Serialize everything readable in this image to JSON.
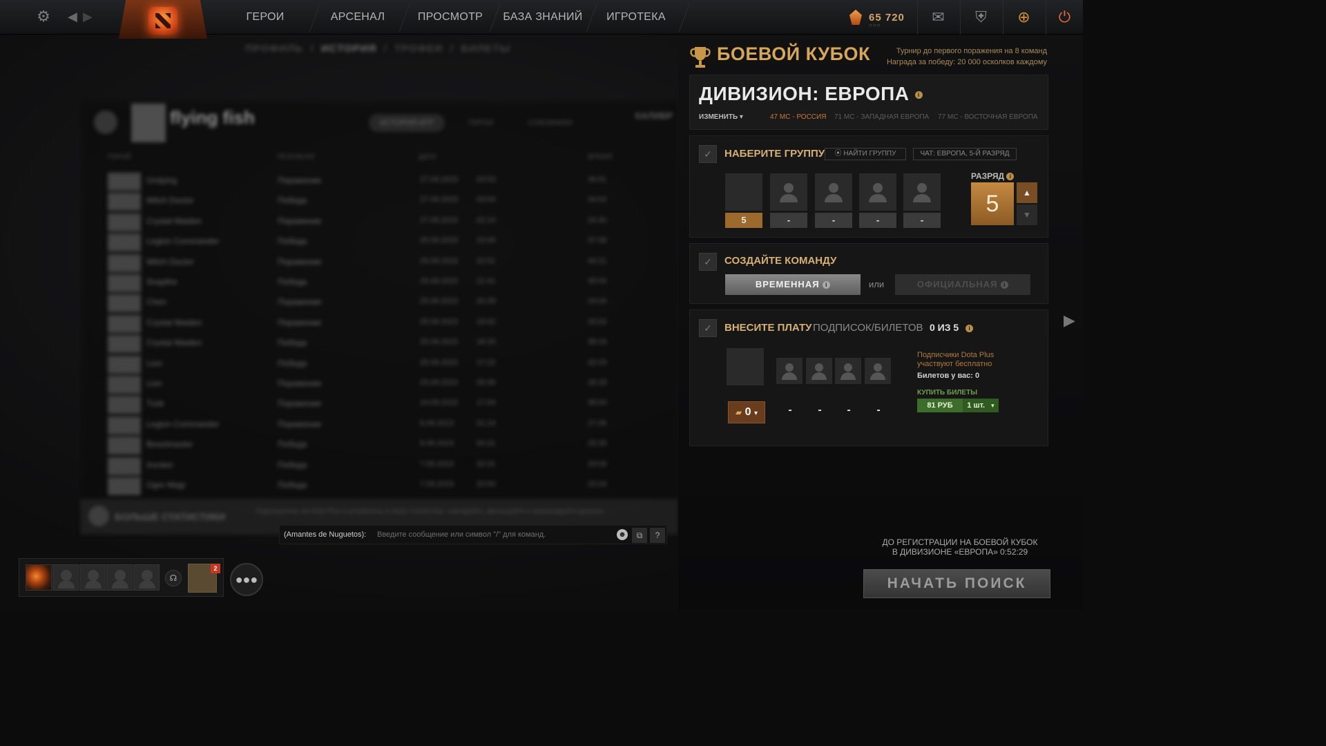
{
  "nav": {
    "items": [
      "ГЕРОИ",
      "АРСЕНАЛ",
      "ПРОСМОТР",
      "БАЗА ЗНАНИЙ",
      "ИГРОТЕКА"
    ],
    "shards": "65 720",
    "shard_sub": "○○○"
  },
  "background": {
    "crumbs": [
      "ПРОФИЛЬ",
      "ИСТОРИЯ",
      "ТРОФЕИ",
      "БИЛЕТЫ"
    ],
    "player_name": "flying fish",
    "tabs": [
      "ИСТОРИЯ ИГР",
      "ГЕРОИ",
      "СОЮЗНИКИ"
    ],
    "columns": [
      "ГЕРОЙ",
      "РЕЗУЛЬТАТ",
      "ДАТА",
      "ВРЕМЯ"
    ],
    "rows": [
      {
        "hero": "Undying",
        "result": "Поражение",
        "date": "27.09.2023",
        "time": "03:53",
        "dur": "36:01"
      },
      {
        "hero": "Witch Doctor",
        "result": "Победа",
        "date": "27.09.2023",
        "time": "03:04",
        "dur": "34:02"
      },
      {
        "hero": "Crystal Maiden",
        "result": "Поражение",
        "date": "27.09.2023",
        "time": "02:14",
        "dur": "24:40"
      },
      {
        "hero": "Legion Commander",
        "result": "Победа",
        "date": "25.09.2023",
        "time": "23:49",
        "dur": "37:08"
      },
      {
        "hero": "Witch Doctor",
        "result": "Поражение",
        "date": "25.09.2023",
        "time": "22:51",
        "dur": "44:21"
      },
      {
        "hero": "Snapfire",
        "result": "Победа",
        "date": "25.09.2023",
        "time": "21:41",
        "dur": "45:04"
      },
      {
        "hero": "Chen",
        "result": "Поражение",
        "date": "25.09.2023",
        "time": "20:39",
        "dur": "24:04"
      },
      {
        "hero": "Crystal Maiden",
        "result": "Поражение",
        "date": "25.09.2023",
        "time": "19:42",
        "dur": "33:02"
      },
      {
        "hero": "Crystal Maiden",
        "result": "Победа",
        "date": "25.09.2023",
        "time": "18:33",
        "dur": "38:16"
      },
      {
        "hero": "Lion",
        "result": "Победа",
        "date": "25.09.2023",
        "time": "17:22",
        "dur": "42:03"
      },
      {
        "hero": "Lion",
        "result": "Поражение",
        "date": "25.09.2023",
        "time": "00:46",
        "dur": "28:28"
      },
      {
        "hero": "Tusk",
        "result": "Поражение",
        "date": "14.09.2023",
        "time": "17:04",
        "dur": "38:00"
      },
      {
        "hero": "Legion Commander",
        "result": "Поражение",
        "date": "8.09.2023",
        "time": "01:24",
        "dur": "27:06"
      },
      {
        "hero": "Beastmaster",
        "result": "Победа",
        "date": "8.09.2023",
        "time": "00:31",
        "dur": "25:35"
      },
      {
        "hero": "Invoker",
        "result": "Победа",
        "date": "7.09.2023",
        "time": "22:31",
        "dur": "29:06"
      },
      {
        "hero": "Ogre Magi",
        "result": "Победа",
        "date": "7.09.2023",
        "time": "20:50",
        "dur": "20:04"
      }
    ],
    "more_stats_title": "БОЛЬШЕ СТАТИСТИКИ",
    "more_stats_desc": "Подпишитесь на Dota Plus и углубитесь в свою статистику: сортируйте, фильтруйте и анализируйте данные...",
    "side_partial": "КАЛИБР"
  },
  "chat": {
    "channel": "(Amantes de Nuguetos):",
    "placeholder": "Введите сообщение или символ \"/\" для команд.",
    "help": "?"
  },
  "party": {
    "friend_badge": "2"
  },
  "battlecup": {
    "title": "БОЕВОЙ КУБОК",
    "sub1": "Турнир до первого поражения на 8 команд",
    "sub2": "Награда за победу: 20 000 осколков каждому",
    "division_title": "ДИВИЗИОН: ЕВРОПА",
    "change": "ИЗМЕНИТЬ ▾",
    "regions": [
      "47 МС - РОССИЯ",
      "71 МС - ЗАПАДНАЯ ЕВРОПА",
      "77 МС - ВОСТОЧНАЯ ЕВРОПА"
    ],
    "step1_title": "НАБЕРИТЕ ГРУППУ",
    "find_group": "НАЙТИ ГРУППУ",
    "chat_label": "ЧАТ: ЕВРОПА, 5-Й РАЗРЯД",
    "slot_labels": [
      "5",
      "-",
      "-",
      "-",
      "-"
    ],
    "rank_label": "РАЗРЯД",
    "rank_value": "5",
    "step2_title": "СОЗДАЙТЕ КОМАНДУ",
    "temp_team": "ВРЕМЕННАЯ",
    "or": "или",
    "official_team": "ОФИЦИАЛЬНАЯ",
    "step3_title": "ВНЕСИТЕ ПЛАТУ",
    "step3_sub": "ПОДПИСОК/БИЛЕТОВ",
    "step3_count": "0 ИЗ 5",
    "ticket_sel": "0",
    "pay_dashes": [
      "-",
      "-",
      "-",
      "-"
    ],
    "plus_note": "Подписчики Dota Plus участвуют бесплатно",
    "tickets_have": "Билетов у вас: 0",
    "buy_label": "КУПИТЬ БИЛЕТЫ",
    "buy_price": "81 РУБ",
    "buy_qty": "1 шт.",
    "reg_line1": "ДО РЕГИСТРАЦИИ НА БОЕВОЙ КУБОК",
    "reg_line2": "В ДИВИЗИОНЕ «ЕВРОПА» 0:52:29",
    "start": "НАЧАТЬ ПОИСК"
  }
}
